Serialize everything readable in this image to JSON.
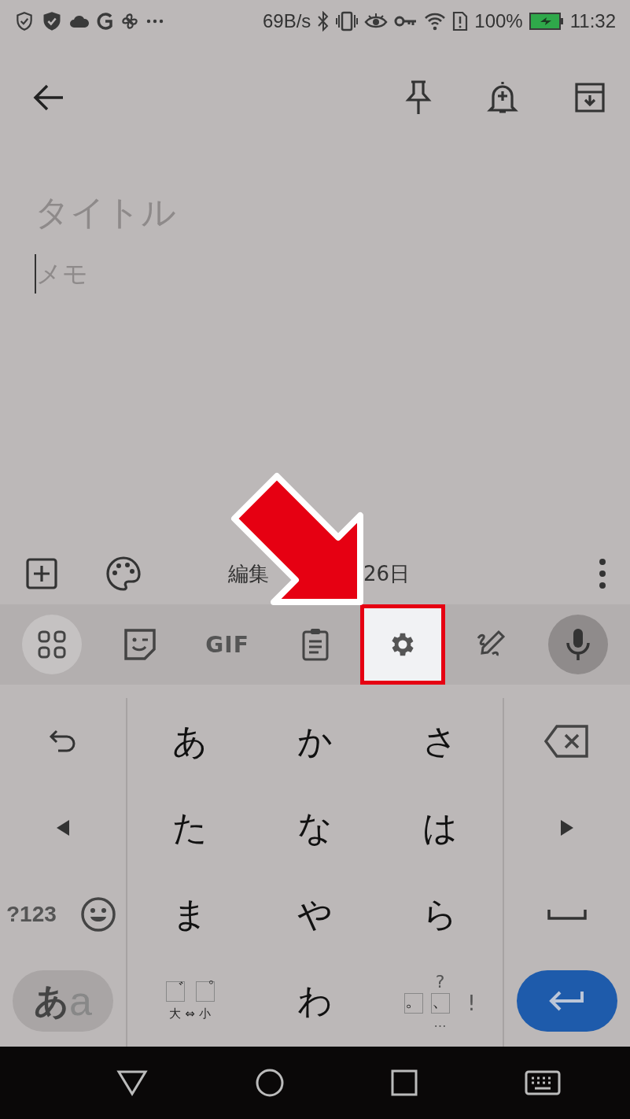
{
  "status_bar": {
    "speed": "69B/s",
    "battery": "100%",
    "time": "11:32"
  },
  "note": {
    "title_placeholder": "タイトル",
    "body_placeholder": "メモ"
  },
  "bottom_bar": {
    "edited_parts": [
      "編集",
      "26日"
    ]
  },
  "keyboard": {
    "toolbar": [
      {
        "kind": "apps",
        "highlighted": false
      },
      {
        "kind": "sticker",
        "highlighted": false
      },
      {
        "kind": "gif",
        "label": "GIF",
        "highlighted": false
      },
      {
        "kind": "clipboard",
        "highlighted": false
      },
      {
        "kind": "settings",
        "highlighted": true
      },
      {
        "kind": "handwriting",
        "highlighted": false
      },
      {
        "kind": "voice",
        "highlighted": false
      }
    ],
    "kana": [
      "あ",
      "か",
      "さ",
      "た",
      "な",
      "は",
      "ま",
      "や",
      "ら",
      "わ"
    ],
    "symbols_key": "?123",
    "mode_key": {
      "main": "あ",
      "alt": "a"
    },
    "dakuten_key": {
      "marks": [
        "゛",
        "゜"
      ],
      "caption": [
        "大",
        "⇔",
        "小"
      ]
    },
    "punctuation_key": {
      "top": "?",
      "marks": [
        "。",
        "、"
      ],
      "right": "!",
      "bottom": "…"
    }
  }
}
